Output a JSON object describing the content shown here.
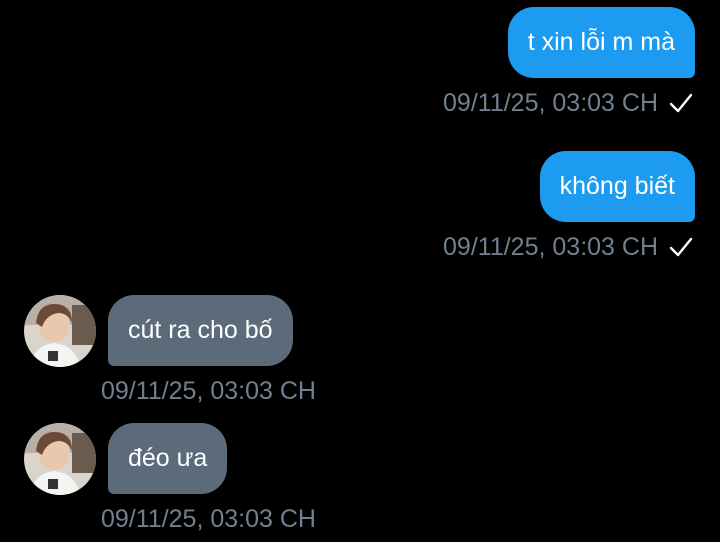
{
  "colors": {
    "background": "#000000",
    "outgoing_bubble": "#1d9bf0",
    "incoming_bubble": "#5b6b7a",
    "timestamp": "#71808f"
  },
  "messages": [
    {
      "direction": "outgoing",
      "text": "t xin lỗi m mà",
      "timestamp": "09/11/25, 03:03 CH",
      "status_icon": "checkmark-icon"
    },
    {
      "direction": "outgoing",
      "text": "không biết",
      "timestamp": "09/11/25, 03:03 CH",
      "status_icon": "checkmark-icon"
    },
    {
      "direction": "incoming",
      "text": "cút ra cho bố",
      "timestamp": "09/11/25, 03:03 CH",
      "avatar": "user-avatar"
    },
    {
      "direction": "incoming",
      "text": "đéo ưa",
      "timestamp": "09/11/25, 03:03 CH",
      "avatar": "user-avatar"
    }
  ]
}
